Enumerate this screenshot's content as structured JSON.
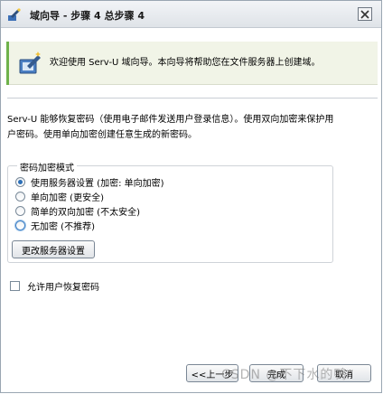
{
  "window": {
    "title": "域向导 - 步骤 4 总步骤 4"
  },
  "banner": {
    "text": "欢迎使用 Serv-U 域向导。本向导将帮助您在文件服务器上创建域。"
  },
  "description": {
    "line1": "Serv-U 能够恢复密码（使用电子邮件发送用户登录信息）。使用双向加密来保护用",
    "line2": "户密码。使用单向加密创建任意生成的新密码。"
  },
  "encryption_mode": {
    "legend": "密码加密模式",
    "options": [
      {
        "label": "使用服务器设置 (加密: 单向加密)",
        "checked": true
      },
      {
        "label": "单向加密 (更安全)",
        "checked": false
      },
      {
        "label": "简单的双向加密 (不太安全)",
        "checked": false
      },
      {
        "label": "无加密 (不推荐)",
        "checked": false
      }
    ],
    "change_button": "更改服务器设置"
  },
  "allow_recovery": {
    "label": "允许用户恢复密码",
    "checked": false
  },
  "footer": {
    "back_button": "<<上一步",
    "finish_button": "完成",
    "cancel_button": "取消",
    "watermark": "CSDN @不下水的鸭"
  },
  "colors": {
    "banner_bg": "#f1f4e7",
    "banner_accent": "#6fb24b",
    "radio_selected": "#2c6fb7"
  }
}
